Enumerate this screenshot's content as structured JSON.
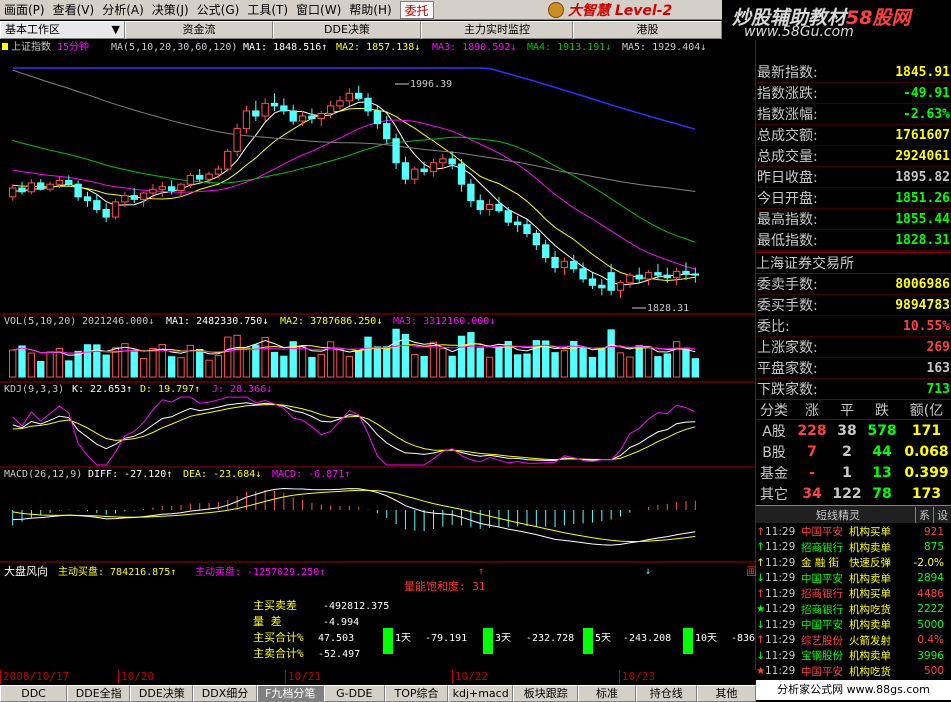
{
  "menu": {
    "items": [
      "画面(P)",
      "查看(V)",
      "分析(A)",
      "决策(J)",
      "公式(G)",
      "工具(T)",
      "窗口(W)",
      "帮助(H)"
    ],
    "hot_item": "委托",
    "brand": "大智慧 Level-2"
  },
  "watermark": {
    "line1_prefix": "炒股辅助教材",
    "line1_highlight": "58股网",
    "line2": "www.58Gu.com"
  },
  "tabs": {
    "active": "基本工作区",
    "items": [
      "资金流",
      "DDE决策",
      "主力实时监控",
      "港股"
    ]
  },
  "main_chart": {
    "title_name": "上证指数",
    "title_period": "15分钟",
    "ma_label": "MA(5,10,20,30,60,120)",
    "ma1": "MA1: 1848.516↑",
    "ma2": "MA2: 1857.138↓",
    "ma3": "MA3: 1890.592↓",
    "ma4": "MA4: 1913.191↓",
    "ma5": "MA5: 1929.404↓",
    "high_mark": "1996.39",
    "low_mark": "1828.31"
  },
  "vol_panel": {
    "label": "VOL(5,10,20)",
    "value": "2021246.000↓",
    "ma1": "MA1: 2482330.750↓",
    "ma2": "MA2: 3787686.250↓",
    "ma3": "MA3: 3312160.000↓"
  },
  "kdj_panel": {
    "label": "KDJ(9,3,3)",
    "k": "K: 22.653↑",
    "d": "D: 19.797↑",
    "j": "J: 28.366↓"
  },
  "macd_panel": {
    "label": "MACD(26,12,9)",
    "diff": "DIFF: -27.120↑",
    "dea": "DEA: -23.684↓",
    "macd": "MACD: -6.871↑"
  },
  "dapan_panel": {
    "label": "大盘风向",
    "buy": "主动买盘: 784216.875↑",
    "sell": "主动卖盘: -1257029.250↑",
    "saturation": "量能饱和度: 31",
    "right_mark": "画",
    "stats": [
      {
        "k": "主买卖差",
        "v": "-492812.375"
      },
      {
        "k": "量    差",
        "v": "-4.994"
      },
      {
        "k": "主买合计%",
        "v": "47.503"
      },
      {
        "k": "主卖合计%",
        "v": "-52.497"
      }
    ],
    "days": [
      {
        "label": "1天",
        "value": "-79.191"
      },
      {
        "label": "3天",
        "value": "-232.728"
      },
      {
        "label": "5天",
        "value": "-243.208"
      },
      {
        "label": "10天",
        "value": "-836"
      }
    ]
  },
  "dates": [
    "2008/10/17",
    "10/20",
    "10/21",
    "10/22",
    "10/23"
  ],
  "info": {
    "rows": [
      {
        "k": "最新指数:",
        "v": "1845.91",
        "c": "#ffff00"
      },
      {
        "k": "指数涨跌:",
        "v": "-49.91",
        "c": "#00ff00"
      },
      {
        "k": "指数涨幅:",
        "v": "-2.63%",
        "c": "#00ff00"
      },
      {
        "k": "总成交额:",
        "v": "1761607",
        "c": "#ffff00"
      },
      {
        "k": "总成交量:",
        "v": "2924061",
        "c": "#ffff00"
      },
      {
        "k": "昨日收盘:",
        "v": "1895.82",
        "c": "#c8c8c8"
      },
      {
        "k": "今日开盘:",
        "v": "1851.26",
        "c": "#00ff00"
      },
      {
        "k": "最高指数:",
        "v": "1855.44",
        "c": "#00ff00"
      },
      {
        "k": "最低指数:",
        "v": "1828.31",
        "c": "#00ff00"
      }
    ],
    "exchange": "上海证券交易所",
    "rows2": [
      {
        "k": "委卖手数:",
        "v": "8006986",
        "c": "#ffff00"
      },
      {
        "k": "委买手数:",
        "v": "9894783",
        "c": "#ffff00"
      },
      {
        "k": "委比:",
        "v": "10.55%",
        "c": "#ff4040"
      },
      {
        "k": "上涨家数:",
        "v": "269",
        "c": "#ff4040"
      },
      {
        "k": "平盘家数:",
        "v": "163",
        "c": "#c8c8c8"
      },
      {
        "k": "下跌家数:",
        "v": "713",
        "c": "#00ff00"
      }
    ],
    "table_header": [
      "分类",
      "涨",
      "平",
      "跌",
      "额(亿"
    ],
    "table_rows": [
      [
        "A股",
        "228",
        "38",
        "578",
        "171"
      ],
      [
        "B股",
        "7",
        "2",
        "44",
        "0.068"
      ],
      [
        "基金",
        "-",
        "1",
        "13",
        "0.399"
      ],
      [
        "其它",
        "34",
        "122",
        "78",
        "173"
      ]
    ]
  },
  "sprite": {
    "title": "短线精灵",
    "btn1": "系",
    "btn2": "设",
    "items": [
      {
        "ar": "↑",
        "t": "11:29",
        "n": "中国平安",
        "a": "机构买单",
        "v": "921",
        "c": "#ff4040"
      },
      {
        "ar": "↑",
        "t": "11:29",
        "n": "招商银行",
        "a": "机构卖单",
        "v": "875",
        "c": "#00ff00"
      },
      {
        "ar": "↑",
        "t": "11:29",
        "n": "金 融 街",
        "a": "快速反弹",
        "v": "-2.0%",
        "c": "#ffff00"
      },
      {
        "ar": "↓",
        "t": "11:29",
        "n": "中国平安",
        "a": "机构卖单",
        "v": "2894",
        "c": "#00ff00"
      },
      {
        "ar": "↑",
        "t": "11:29",
        "n": "招商银行",
        "a": "机构买单",
        "v": "4486",
        "c": "#ff4040"
      },
      {
        "ar": "★",
        "t": "11:29",
        "n": "招商银行",
        "a": "机构吃货",
        "v": "2222",
        "c": "#00ff00"
      },
      {
        "ar": "↓",
        "t": "11:29",
        "n": "中国平安",
        "a": "机构卖单",
        "v": "5000",
        "c": "#00ff00"
      },
      {
        "ar": "↑",
        "t": "11:29",
        "n": "综艺股份",
        "a": "火箭发射",
        "v": "0.4%",
        "c": "#ff4040"
      },
      {
        "ar": "↓",
        "t": "11:29",
        "n": "宝钢股份",
        "a": "机构卖单",
        "v": "3996",
        "c": "#00ff00"
      },
      {
        "ar": "★",
        "t": "11:29",
        "n": "中国平安",
        "a": "机构吃货",
        "v": "500",
        "c": "#ff4040"
      },
      {
        "ar": "↑",
        "t": "11:29",
        "n": "中国平安",
        "a": "机构买单",
        "v": "",
        "c": "#ff4040"
      }
    ],
    "ad": "分析家公式网 www.88gs.com"
  },
  "bottom_tabs": [
    "DDC",
    "DDE全指",
    "DDE决策",
    "DDX细分",
    "F九档分笔",
    "G-DDE",
    "TOP综合",
    "kdj+macd",
    "板块跟踪",
    "标准",
    "持仓线",
    "其他"
  ],
  "bottom_active": "F九档分笔",
  "colors": {
    "up": "#ff5050",
    "down": "#54ffff",
    "ma1": "#ffffff",
    "ma2": "#ffff00",
    "ma3": "#ff00ff",
    "ma4": "#00c000",
    "ma5": "#808080",
    "ma6": "#3030ff"
  },
  "chart_data": [
    {
      "type": "candlestick",
      "title": "上证指数 15分钟",
      "x": [
        "10/17",
        "10/17",
        "10/17",
        "10/17",
        "10/17",
        "10/17",
        "10/17",
        "10/17",
        "10/17",
        "10/17",
        "10/17",
        "10/17",
        "10/17",
        "10/17",
        "10/17",
        "10/17",
        "10/20",
        "10/20",
        "10/20",
        "10/20",
        "10/20",
        "10/20",
        "10/20",
        "10/20",
        "10/20",
        "10/20",
        "10/20",
        "10/20",
        "10/20",
        "10/20",
        "10/20",
        "10/20",
        "10/21",
        "10/21",
        "10/21",
        "10/21",
        "10/21",
        "10/21",
        "10/21",
        "10/21",
        "10/21",
        "10/21",
        "10/21",
        "10/21",
        "10/21",
        "10/21",
        "10/21",
        "10/21",
        "10/22",
        "10/22",
        "10/22",
        "10/22",
        "10/22",
        "10/22",
        "10/22",
        "10/22",
        "10/22",
        "10/22",
        "10/22",
        "10/22",
        "10/22",
        "10/22",
        "10/22",
        "10/22",
        "10/23",
        "10/23",
        "10/23",
        "10/23",
        "10/23",
        "10/23",
        "10/23",
        "10/23",
        "10/23",
        "10/23"
      ],
      "ohlc": [
        [
          1908,
          1918,
          1905,
          1915
        ],
        [
          1915,
          1920,
          1910,
          1912
        ],
        [
          1912,
          1922,
          1910,
          1919
        ],
        [
          1919,
          1922,
          1913,
          1914
        ],
        [
          1914,
          1920,
          1912,
          1918
        ],
        [
          1918,
          1924,
          1915,
          1921
        ],
        [
          1921,
          1925,
          1917,
          1918
        ],
        [
          1918,
          1921,
          1905,
          1908
        ],
        [
          1908,
          1912,
          1900,
          1905
        ],
        [
          1905,
          1910,
          1895,
          1898
        ],
        [
          1898,
          1903,
          1888,
          1892
        ],
        [
          1892,
          1906,
          1890,
          1904
        ],
        [
          1904,
          1912,
          1900,
          1909
        ],
        [
          1909,
          1915,
          1903,
          1906
        ],
        [
          1906,
          1912,
          1900,
          1911
        ],
        [
          1911,
          1918,
          1906,
          1914
        ],
        [
          1914,
          1920,
          1908,
          1916
        ],
        [
          1916,
          1921,
          1910,
          1913
        ],
        [
          1913,
          1919,
          1908,
          1918
        ],
        [
          1918,
          1927,
          1915,
          1925
        ],
        [
          1925,
          1930,
          1920,
          1922
        ],
        [
          1922,
          1928,
          1918,
          1926
        ],
        [
          1926,
          1933,
          1923,
          1930
        ],
        [
          1930,
          1946,
          1928,
          1944
        ],
        [
          1944,
          1966,
          1940,
          1962
        ],
        [
          1962,
          1980,
          1958,
          1976
        ],
        [
          1976,
          1984,
          1968,
          1972
        ],
        [
          1972,
          1986,
          1968,
          1982
        ],
        [
          1982,
          1990,
          1976,
          1980
        ],
        [
          1980,
          1986,
          1973,
          1976
        ],
        [
          1976,
          1981,
          1965,
          1968
        ],
        [
          1968,
          1976,
          1964,
          1972
        ],
        [
          1972,
          1978,
          1966,
          1970
        ],
        [
          1970,
          1976,
          1964,
          1974
        ],
        [
          1974,
          1984,
          1970,
          1980
        ],
        [
          1980,
          1988,
          1976,
          1984
        ],
        [
          1984,
          1994,
          1980,
          1990
        ],
        [
          1990,
          1996,
          1984,
          1986
        ],
        [
          1986,
          1990,
          1972,
          1976
        ],
        [
          1976,
          1980,
          1962,
          1966
        ],
        [
          1966,
          1972,
          1950,
          1954
        ],
        [
          1954,
          1958,
          1930,
          1935
        ],
        [
          1935,
          1940,
          1918,
          1922
        ],
        [
          1922,
          1932,
          1918,
          1930
        ],
        [
          1930,
          1936,
          1925,
          1928
        ],
        [
          1928,
          1938,
          1924,
          1935
        ],
        [
          1935,
          1942,
          1930,
          1938
        ],
        [
          1938,
          1944,
          1930,
          1934
        ],
        [
          1934,
          1938,
          1912,
          1918
        ],
        [
          1918,
          1922,
          1900,
          1905
        ],
        [
          1905,
          1910,
          1894,
          1898
        ],
        [
          1898,
          1906,
          1893,
          1902
        ],
        [
          1902,
          1908,
          1895,
          1897
        ],
        [
          1897,
          1900,
          1885,
          1888
        ],
        [
          1888,
          1893,
          1880,
          1886
        ],
        [
          1886,
          1890,
          1876,
          1879
        ],
        [
          1879,
          1882,
          1866,
          1870
        ],
        [
          1870,
          1874,
          1856,
          1860
        ],
        [
          1860,
          1865,
          1848,
          1852
        ],
        [
          1852,
          1860,
          1846,
          1857
        ],
        [
          1857,
          1862,
          1848,
          1851
        ],
        [
          1851,
          1856,
          1840,
          1843
        ],
        [
          1843,
          1848,
          1835,
          1838
        ],
        [
          1838,
          1843,
          1830,
          1836
        ],
        [
          1848,
          1855,
          1830,
          1834
        ],
        [
          1834,
          1842,
          1828,
          1840
        ],
        [
          1840,
          1848,
          1836,
          1846
        ],
        [
          1846,
          1852,
          1840,
          1843
        ],
        [
          1843,
          1850,
          1838,
          1848
        ],
        [
          1848,
          1855,
          1842,
          1846
        ],
        [
          1846,
          1852,
          1840,
          1844
        ],
        [
          1844,
          1852,
          1838,
          1849
        ],
        [
          1849,
          1856,
          1842,
          1847
        ],
        [
          1847,
          1852,
          1840,
          1846
        ]
      ],
      "ylim": [
        1820,
        2010
      ]
    }
  ]
}
